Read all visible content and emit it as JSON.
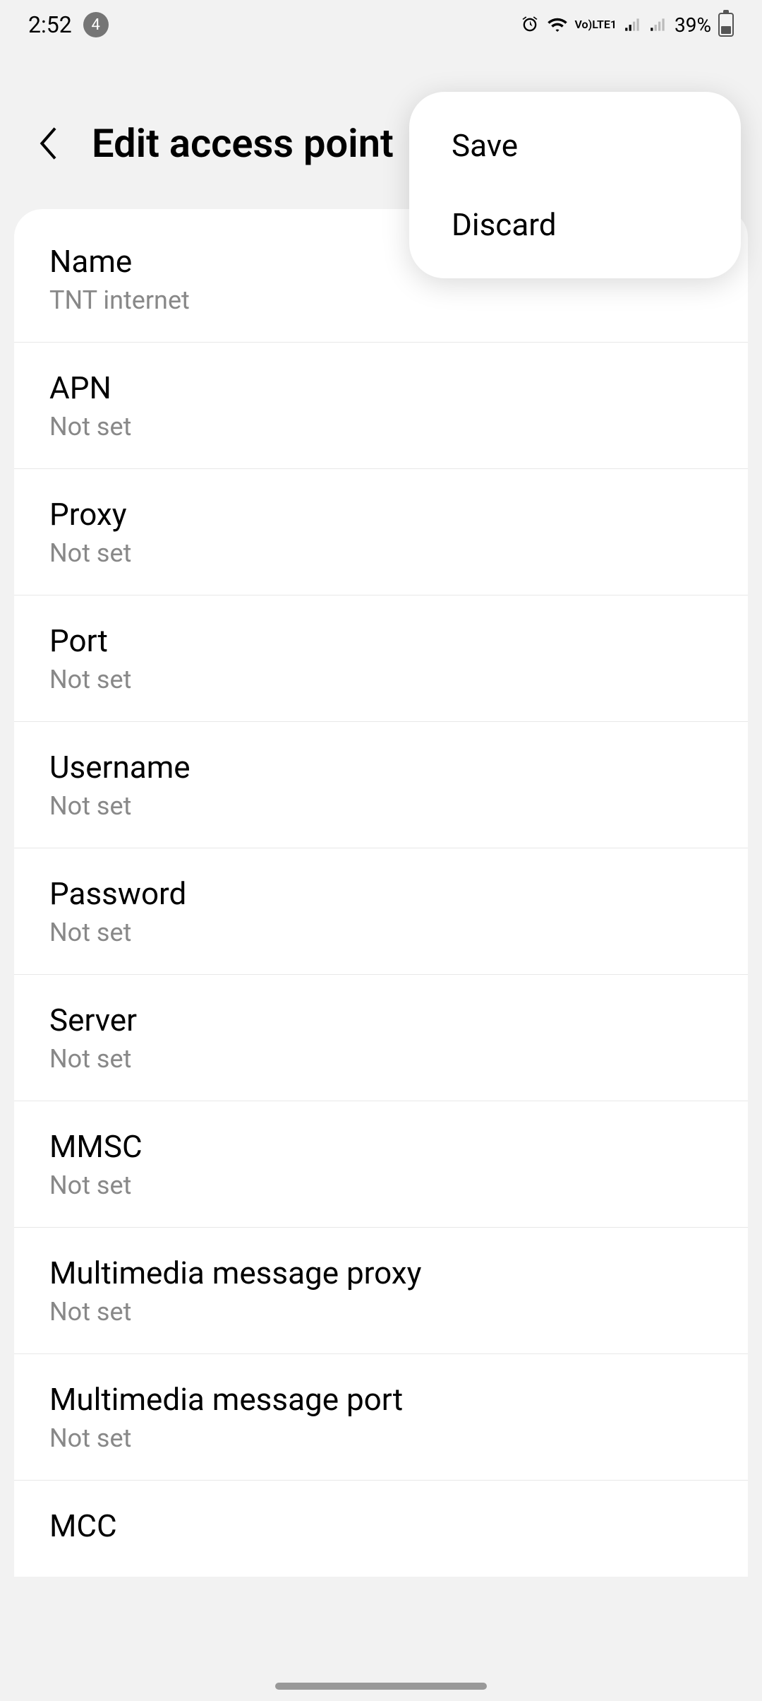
{
  "status_bar": {
    "time": "2:52",
    "notification_count": "4",
    "battery_percent": "39%",
    "lte_label": "LTE1"
  },
  "header": {
    "title": "Edit access point"
  },
  "popup": {
    "save_label": "Save",
    "discard_label": "Discard"
  },
  "settings": [
    {
      "label": "Name",
      "value": "TNT internet"
    },
    {
      "label": "APN",
      "value": "Not set"
    },
    {
      "label": "Proxy",
      "value": "Not set"
    },
    {
      "label": "Port",
      "value": "Not set"
    },
    {
      "label": "Username",
      "value": "Not set"
    },
    {
      "label": "Password",
      "value": "Not set"
    },
    {
      "label": "Server",
      "value": "Not set"
    },
    {
      "label": "MMSC",
      "value": "Not set"
    },
    {
      "label": "Multimedia message proxy",
      "value": "Not set"
    },
    {
      "label": "Multimedia message port",
      "value": "Not set"
    },
    {
      "label": "MCC",
      "value": ""
    }
  ]
}
